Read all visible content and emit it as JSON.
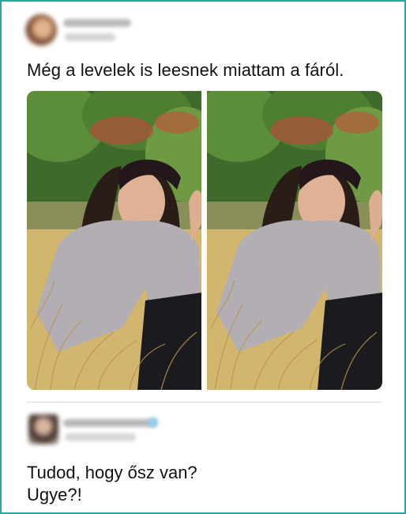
{
  "post": {
    "text": "Még a levelek is leesnek miattam a fáról.",
    "photos": [
      {
        "description_icon": "photo-image"
      },
      {
        "description_icon": "photo-image"
      }
    ]
  },
  "reply": {
    "line1": "Tudod, hogy ősz van?",
    "line2": "Ugye?!"
  },
  "colors": {
    "frame_border": "#2aa7a0",
    "text": "#111111",
    "divider": "#dcdcdc"
  }
}
